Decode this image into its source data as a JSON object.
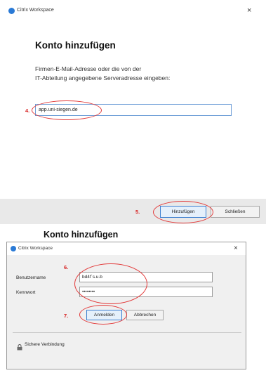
{
  "window": {
    "app_title": "Citrix Workspace",
    "close_symbol": "×"
  },
  "add_account": {
    "heading": "Konto hinzufügen",
    "description_line1": "Firmen-E-Mail-Adresse oder die von der",
    "description_line2": "IT-Abteilung angegebene Serveradresse eingeben:",
    "server_input_value": "app.uni-siegen.de",
    "step_number": "4."
  },
  "footer": {
    "add_button_label": "Hinzufügen",
    "close_button_label": "Schließen",
    "step_number": "5."
  },
  "login_dialog": {
    "page_heading": "Konto hinzufügen",
    "title": "Citrix Workspace",
    "close_symbol": "×",
    "username_label": "Benutzername",
    "username_value": "bd4f`s.u.b",
    "password_label": "Kennwort",
    "password_value": "••••••••",
    "step_number_credentials": "6.",
    "login_button_label": "Anmelden",
    "cancel_button_label": "Abbrechen",
    "step_number_login": "7.",
    "secure_connection_label": "Sichere Verbindung"
  },
  "colors": {
    "annotation_red": "#e23a3a",
    "citrix_blue": "#2a7ad6",
    "input_border": "#6a9bd6"
  }
}
